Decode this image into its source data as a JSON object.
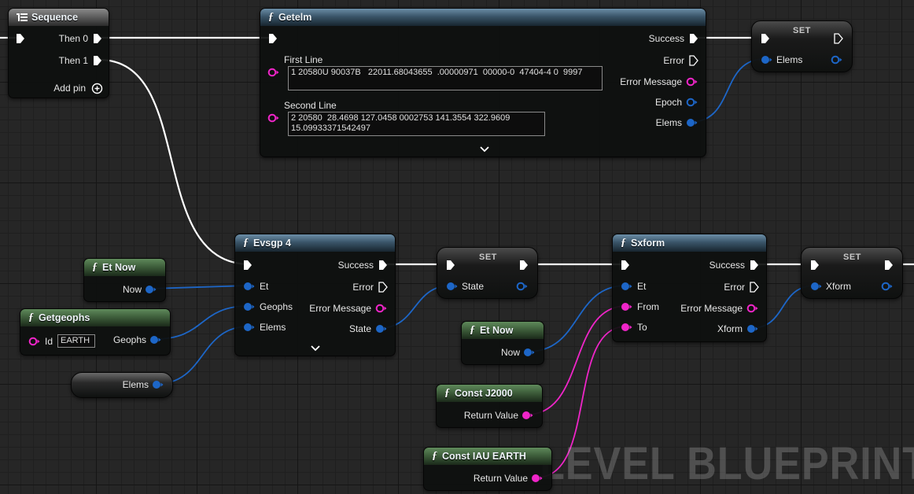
{
  "watermark": "LEVEL BLUEPRINT",
  "colors": {
    "exec": "#ffffff",
    "struct": "#1d66c7",
    "string": "#ef25c8",
    "header_blue": "#3a5569",
    "header_green": "#3b5a38",
    "background": "#262626"
  },
  "sequence": {
    "title": "Sequence",
    "then0": "Then 0",
    "then1": "Then 1",
    "add_pin": "Add pin"
  },
  "getelm": {
    "title": "Getelm",
    "first_line_label": "First Line",
    "first_line_value": "1 20580U 90037B   22011.68043655  .00000971  00000-0  47404-4 0  9997",
    "second_line_label": "Second Line",
    "second_line_value": "2 20580  28.4698 127.0458 0002753 141.3554 322.9609 15.09933371542497",
    "success": "Success",
    "error": "Error",
    "error_message": "Error Message",
    "epoch": "Epoch",
    "elems": "Elems"
  },
  "set_elems": {
    "title": "SET",
    "pin": "Elems"
  },
  "et_now_1": {
    "title": "Et Now",
    "pin": "Now"
  },
  "getgeophs": {
    "title": "Getgeophs",
    "id_label": "Id",
    "id_value": "EARTH",
    "out": "Geophs"
  },
  "elems_var": {
    "pin": "Elems"
  },
  "evsgp4": {
    "title": "Evsgp 4",
    "et": "Et",
    "geophs": "Geophs",
    "elems": "Elems",
    "success": "Success",
    "error": "Error",
    "error_message": "Error Message",
    "state": "State"
  },
  "set_state": {
    "title": "SET",
    "pin": "State"
  },
  "et_now_2": {
    "title": "Et Now",
    "pin": "Now"
  },
  "const_j2000": {
    "title": "Const J2000",
    "pin": "Return Value"
  },
  "const_iau": {
    "title": "Const IAU EARTH",
    "pin": "Return Value"
  },
  "sxform": {
    "title": "Sxform",
    "et": "Et",
    "from": "From",
    "to": "To",
    "success": "Success",
    "error": "Error",
    "error_message": "Error Message",
    "xform": "Xform"
  },
  "set_xform": {
    "title": "SET",
    "pin": "Xform"
  }
}
